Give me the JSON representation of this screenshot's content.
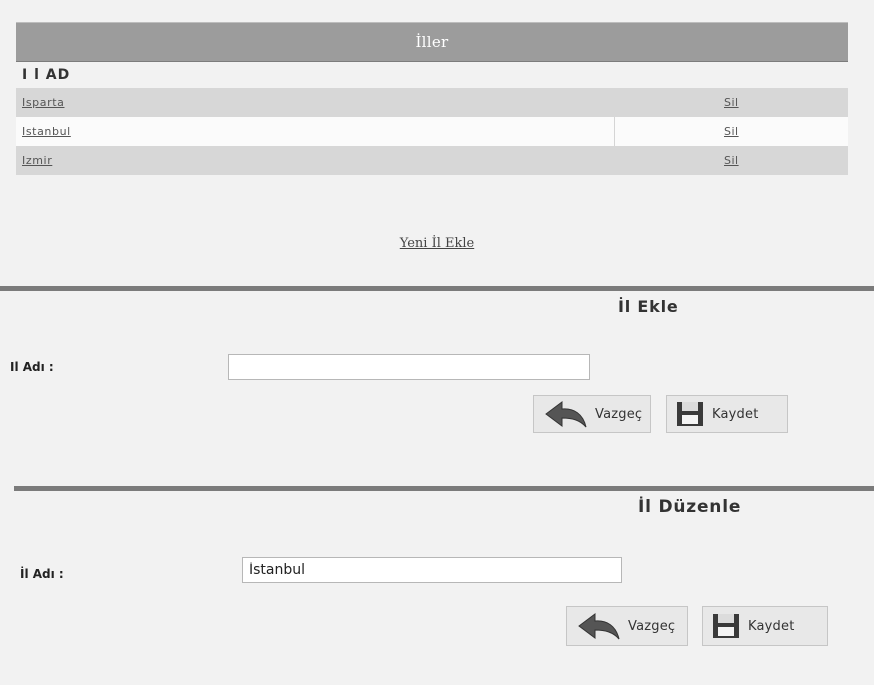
{
  "grid": {
    "title": "İller",
    "column_header": "I l AD",
    "rows": [
      {
        "name": "Isparta",
        "delete": "Sil"
      },
      {
        "name": "Istanbul",
        "delete": "Sil"
      },
      {
        "name": "Izmir",
        "delete": "Sil"
      }
    ],
    "add_link": "Yeni İl Ekle"
  },
  "add_form": {
    "title": "İl Ekle",
    "label": "Il Adı :",
    "value": "",
    "cancel_label": "Vazgeç",
    "save_label": "Kaydet"
  },
  "edit_form": {
    "title": "İl Düzenle",
    "label": "İl Adı :",
    "value": "İstanbul",
    "cancel_label": "Vazgeç",
    "save_label": "Kaydet"
  },
  "icons": {
    "cancel": "undo-arrow-icon",
    "save": "floppy-disk-icon"
  }
}
